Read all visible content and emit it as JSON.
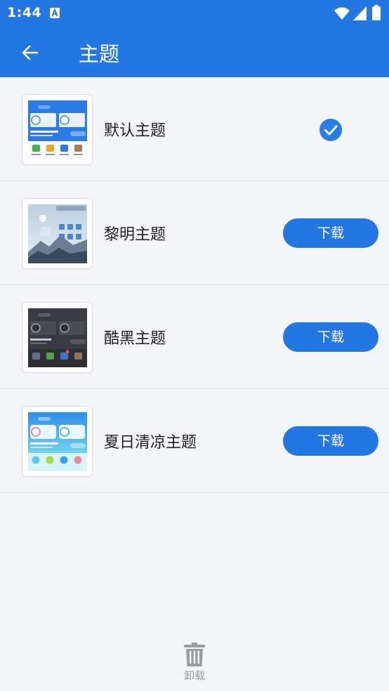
{
  "status_bar": {
    "time": "1:44",
    "icons": [
      "notification-a-icon",
      "wifi-icon",
      "signal-icon",
      "battery-icon"
    ]
  },
  "app_bar": {
    "title": "主题",
    "back_icon": "arrow-left-icon"
  },
  "themes": [
    {
      "name": "默认主题",
      "state": "selected",
      "action_icon": "check-circle-icon"
    },
    {
      "name": "黎明主题",
      "state": "available",
      "button_label": "下载"
    },
    {
      "name": "酷黑主题",
      "state": "available",
      "button_label": "下载"
    },
    {
      "name": "夏日清凉主题",
      "state": "available",
      "button_label": "下载"
    }
  ],
  "bottom": {
    "uninstall_label": "卸载",
    "icon": "trash-icon"
  },
  "colors": {
    "primary": "#2477e3",
    "background": "#f4f5f8",
    "text": "#222222",
    "muted": "#9a9ca2"
  }
}
